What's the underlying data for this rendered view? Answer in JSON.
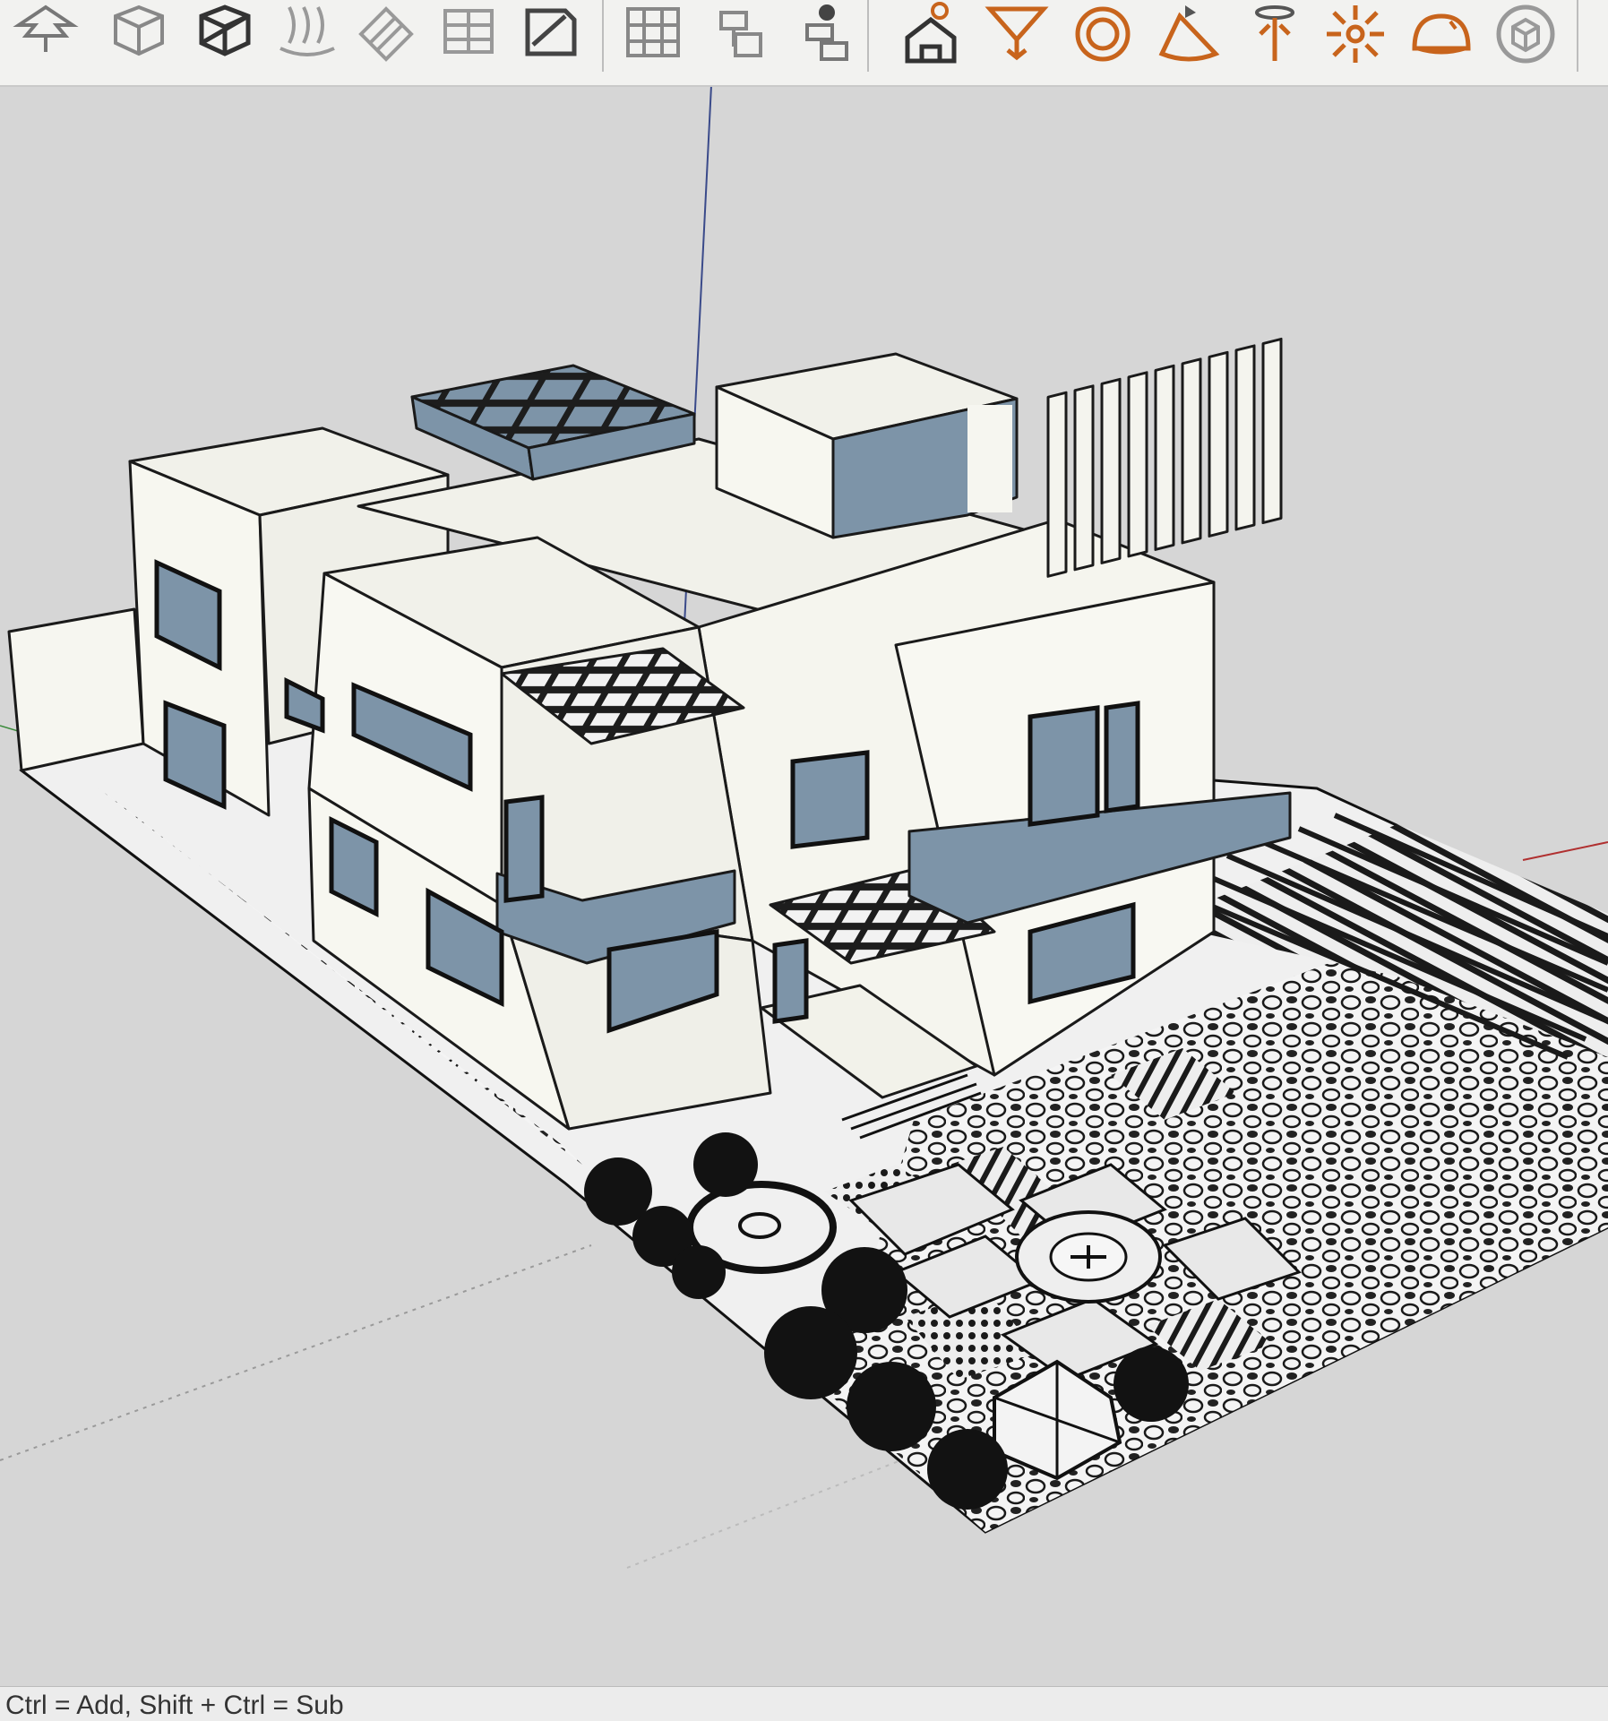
{
  "toolbar": {
    "tools": [
      {
        "icon": "tree-icon"
      },
      {
        "icon": "box-icon"
      },
      {
        "icon": "section-cube-icon"
      },
      {
        "icon": "sandbox-icon"
      },
      {
        "icon": "push-pull-icon"
      },
      {
        "icon": "stairs-icon"
      },
      {
        "icon": "sheet-icon"
      },
      {
        "icon": "grid-icon"
      },
      {
        "icon": "component-tree-icon"
      },
      {
        "icon": "component-eye-icon"
      },
      {
        "icon": "render-house-sun-icon"
      },
      {
        "icon": "render-spotlight-icon"
      },
      {
        "icon": "render-sphere-icon"
      },
      {
        "icon": "render-cone-light-icon"
      },
      {
        "icon": "render-lamp-icon"
      },
      {
        "icon": "render-omni-light-icon"
      },
      {
        "icon": "render-dome-light-icon"
      },
      {
        "icon": "render-proxy-icon"
      }
    ],
    "accent_orange": "#c8641c",
    "icon_gray": "#777777"
  },
  "viewport": {
    "background": "#d6d6d6",
    "glass_color": "#7d94a8",
    "wall_color": "#f7f7f0"
  },
  "statusbar": {
    "text": "Ctrl = Add, Shift + Ctrl = Sub"
  }
}
